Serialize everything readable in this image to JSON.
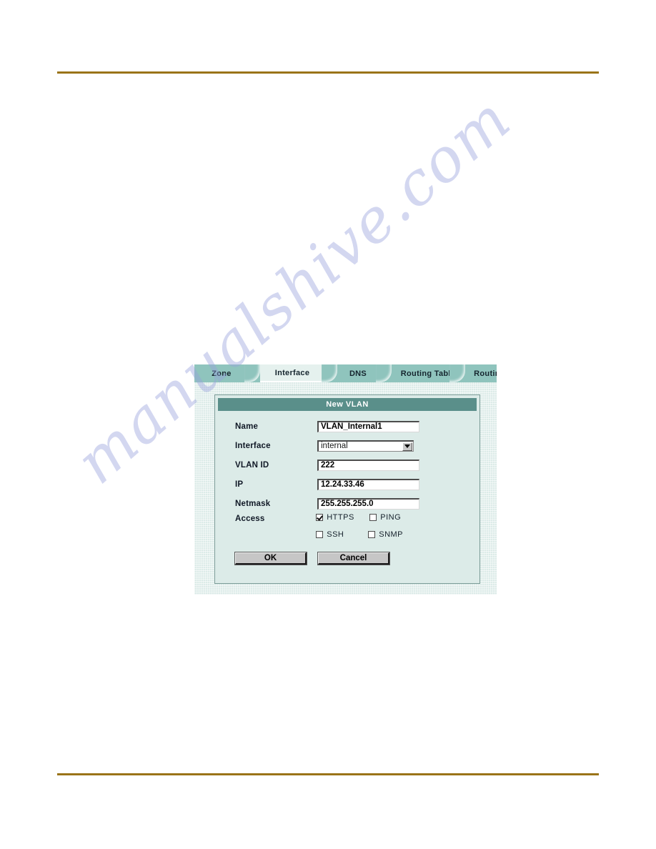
{
  "page": {
    "rule_color": "#9a7418",
    "background": "#ffffff",
    "watermark_text": "manualshive.com"
  },
  "screenshot": {
    "tabs": [
      {
        "label": "Zone",
        "active": false
      },
      {
        "label": "Interface",
        "active": true
      },
      {
        "label": "DNS",
        "active": false
      },
      {
        "label": "Routing Table",
        "active": false
      },
      {
        "label": "Routing",
        "active": false
      }
    ],
    "dialog": {
      "title": "New VLAN",
      "fields": [
        {
          "label": "Name",
          "value": "VLAN_Internal1",
          "type": "text"
        },
        {
          "label": "Interface",
          "value": "internal",
          "type": "select"
        },
        {
          "label": "VLAN ID",
          "value": "222",
          "type": "text"
        },
        {
          "label": "IP",
          "value": "12.24.33.46",
          "type": "text"
        },
        {
          "label": "Netmask",
          "value": "255.255.255.0",
          "type": "text"
        }
      ],
      "access": {
        "label": "Access",
        "options": [
          {
            "label": "HTTPS",
            "checked": true
          },
          {
            "label": "PING",
            "checked": false
          },
          {
            "label": "SSH",
            "checked": false
          },
          {
            "label": "SNMP",
            "checked": false
          }
        ]
      },
      "buttons": {
        "ok": "OK",
        "cancel": "Cancel"
      }
    },
    "colors": {
      "tabbar": "#8fc4bd",
      "panel_body": "#dcebe8",
      "title_bar": "#5a8f8a",
      "button_face": "#c6c6c6"
    }
  }
}
